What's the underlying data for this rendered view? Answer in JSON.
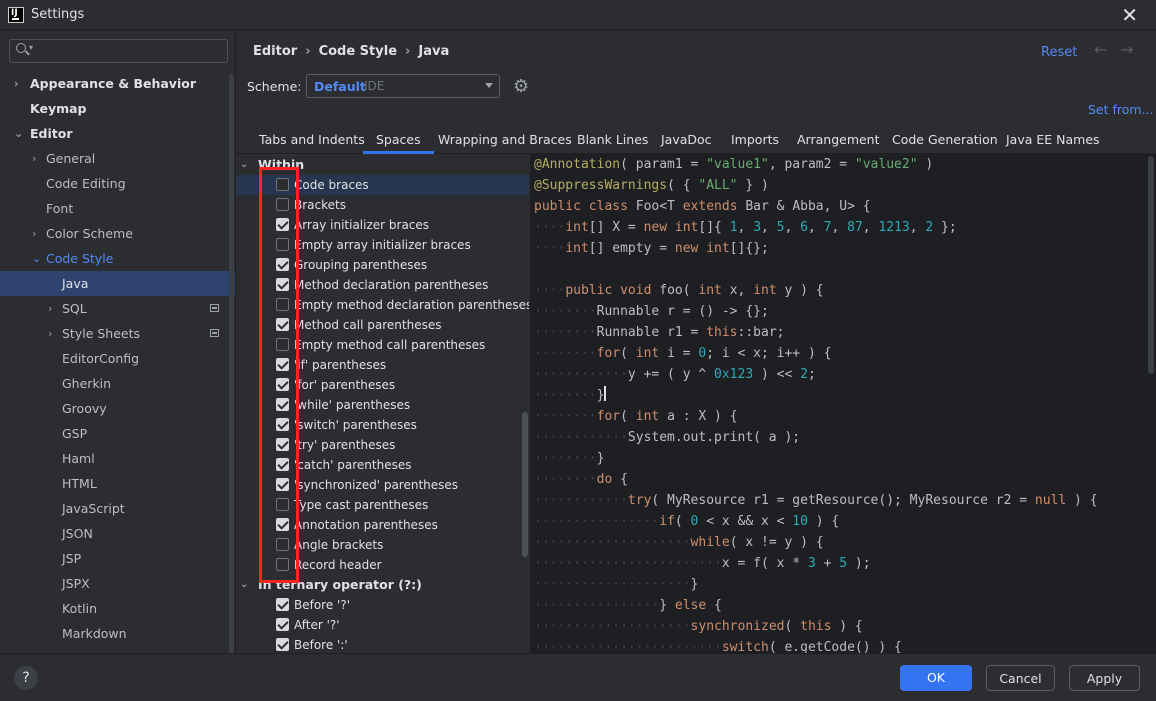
{
  "window": {
    "title": "Settings"
  },
  "search": {
    "placeholder": ""
  },
  "sidebar": {
    "items": [
      {
        "label": "Appearance & Behavior"
      },
      {
        "label": "Keymap"
      },
      {
        "label": "Editor"
      },
      {
        "label": "General"
      },
      {
        "label": "Code Editing"
      },
      {
        "label": "Font"
      },
      {
        "label": "Color Scheme"
      },
      {
        "label": "Code Style"
      },
      {
        "label": "Java"
      },
      {
        "label": "SQL"
      },
      {
        "label": "Style Sheets"
      },
      {
        "label": "EditorConfig"
      },
      {
        "label": "Gherkin"
      },
      {
        "label": "Groovy"
      },
      {
        "label": "GSP"
      },
      {
        "label": "Haml"
      },
      {
        "label": "HTML"
      },
      {
        "label": "JavaScript"
      },
      {
        "label": "JSON"
      },
      {
        "label": "JSP"
      },
      {
        "label": "JSPX"
      },
      {
        "label": "Kotlin"
      },
      {
        "label": "Markdown"
      }
    ]
  },
  "header": {
    "breadcrumb": [
      "Editor",
      "Code Style",
      "Java"
    ],
    "reset": "Reset",
    "back_arrow": "←",
    "forward_arrow": "→"
  },
  "scheme": {
    "label": "Scheme:",
    "name": "Default",
    "sub": "IDE",
    "set_from": "Set from..."
  },
  "tabs": [
    {
      "label": "Tabs and Indents"
    },
    {
      "label": "Spaces"
    },
    {
      "label": "Wrapping and Braces"
    },
    {
      "label": "Blank Lines"
    },
    {
      "label": "JavaDoc"
    },
    {
      "label": "Imports"
    },
    {
      "label": "Arrangement"
    },
    {
      "label": "Code Generation"
    },
    {
      "label": "Java EE Names"
    }
  ],
  "active_tab": "Spaces",
  "options": {
    "group_within": "Within",
    "within": [
      {
        "label": "Code braces",
        "checked": false
      },
      {
        "label": "Brackets",
        "checked": false
      },
      {
        "label": "Array initializer braces",
        "checked": true
      },
      {
        "label": "Empty array initializer braces",
        "checked": false
      },
      {
        "label": "Grouping parentheses",
        "checked": true
      },
      {
        "label": "Method declaration parentheses",
        "checked": true
      },
      {
        "label": "Empty method declaration parentheses",
        "checked": false
      },
      {
        "label": "Method call parentheses",
        "checked": true
      },
      {
        "label": "Empty method call parentheses",
        "checked": false
      },
      {
        "label": "'if' parentheses",
        "checked": true
      },
      {
        "label": "'for' parentheses",
        "checked": true
      },
      {
        "label": "'while' parentheses",
        "checked": true
      },
      {
        "label": "'switch' parentheses",
        "checked": true
      },
      {
        "label": "'try' parentheses",
        "checked": true
      },
      {
        "label": "'catch' parentheses",
        "checked": true
      },
      {
        "label": "'synchronized' parentheses",
        "checked": true
      },
      {
        "label": "Type cast parentheses",
        "checked": false
      },
      {
        "label": "Annotation parentheses",
        "checked": true
      },
      {
        "label": "Angle brackets",
        "checked": false
      },
      {
        "label": "Record header",
        "checked": false
      }
    ],
    "group_ternary": "In ternary operator (?:)",
    "ternary": [
      {
        "label": "Before '?'",
        "checked": true
      },
      {
        "label": "After '?'",
        "checked": true
      },
      {
        "label": "Before ':'",
        "checked": true
      }
    ]
  },
  "code_lines": [
    "@Annotation( param1 = \"value1\", param2 = \"value2\" )",
    "@SuppressWarnings( { \"ALL\" } )",
    "public class Foo<T extends Bar & Abba, U> {",
    "····int[] X = new int[]{ 1, 3, 5, 6, 7, 87, 1213, 2 };",
    "····int[] empty = new int[]{};",
    "",
    "····public void foo( int x, int y ) {",
    "········Runnable r = () -> {};",
    "········Runnable r1 = this::bar;",
    "········for( int i = 0; i < x; i++ ) {",
    "············y += ( y ^ 0x123 ) << 2;",
    "········}",
    "········for( int a : X ) {",
    "············System.out.print( a );",
    "········}",
    "········do {",
    "············try( MyResource r1 = getResource(); MyResource r2 = null ) {",
    "················if( 0 < x && x < 10 ) {",
    "····················while( x != y ) {",
    "························x = f( x * 3 + 5 );",
    "····················}",
    "················} else {",
    "····················synchronized( this ) {",
    "························switch( e.getCode() ) {"
  ],
  "footer": {
    "help": "?",
    "ok": "OK",
    "cancel": "Cancel",
    "apply": "Apply"
  },
  "colors": {
    "accent": "#3574f0",
    "link": "#548af7",
    "highlight": "#ff2222"
  }
}
